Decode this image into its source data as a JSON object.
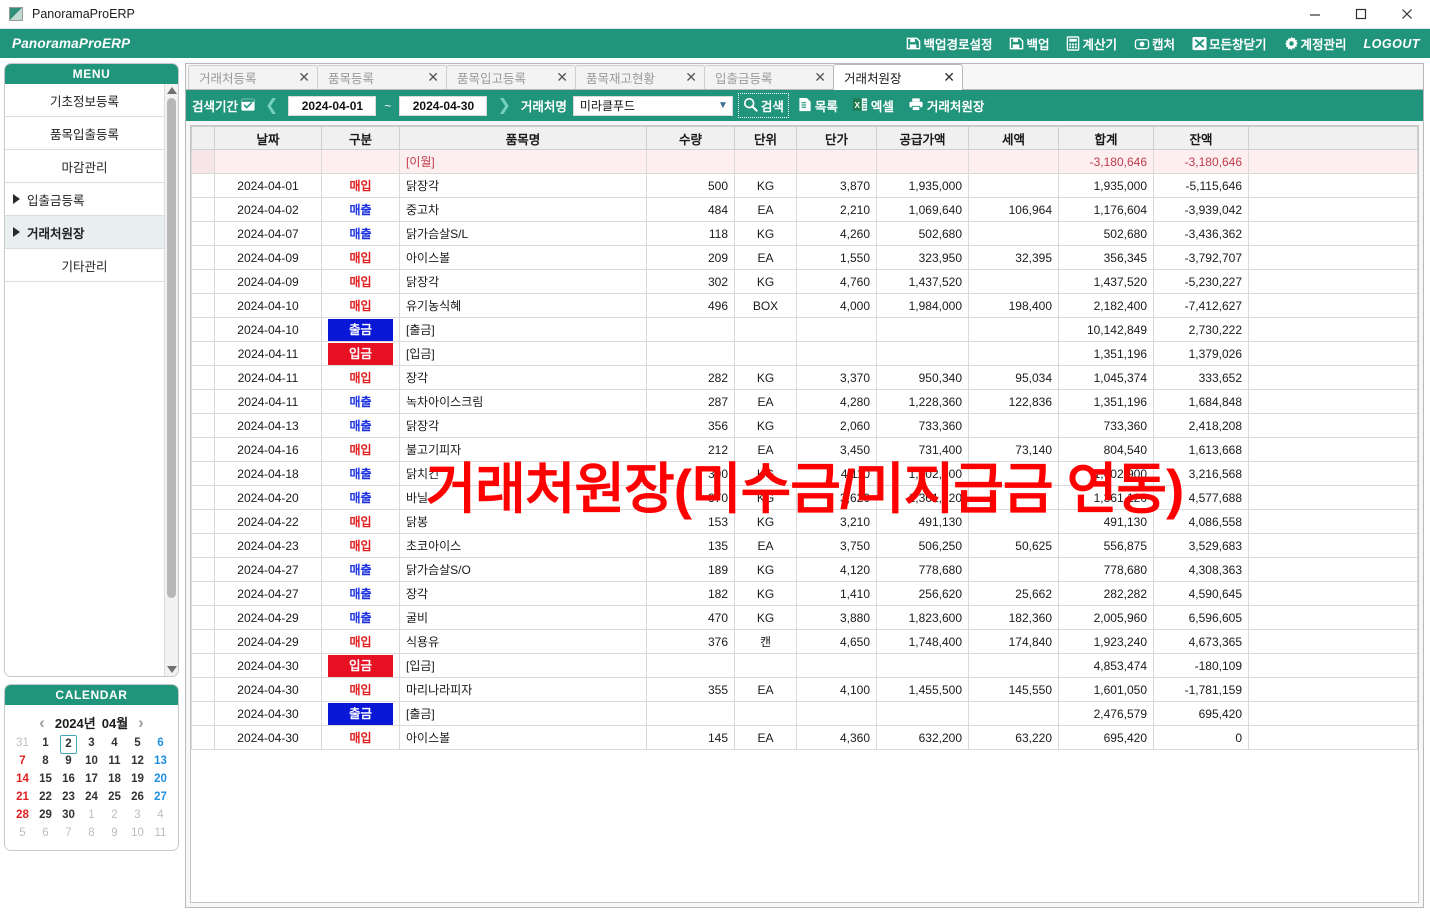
{
  "window": {
    "title": "PanoramaProERP",
    "minimize": "–",
    "maximize": "□",
    "close": "×"
  },
  "brand": {
    "logo": "PanoramaProERP",
    "logout": "LOGOUT",
    "accent": "#21947c",
    "topnav": [
      {
        "icon": "save-path-icon",
        "label": "백업경로설정"
      },
      {
        "icon": "save-icon",
        "label": "백업"
      },
      {
        "icon": "calculator-icon",
        "label": "계산기"
      },
      {
        "icon": "capture-icon",
        "label": "캡처"
      },
      {
        "icon": "close-all-windows-icon",
        "label": "모든창닫기"
      },
      {
        "icon": "gear-icon",
        "label": "계정관리"
      }
    ]
  },
  "sidebar": {
    "menu_title": "MENU",
    "items": [
      {
        "label": "기초정보등록",
        "arrow": false,
        "active": false
      },
      {
        "label": "품목입출등록",
        "arrow": false,
        "active": false
      },
      {
        "label": "마감관리",
        "arrow": false,
        "active": false
      },
      {
        "label": "입출금등록",
        "arrow": true,
        "active": false
      },
      {
        "label": "거래처원장",
        "arrow": true,
        "active": true
      },
      {
        "label": "기타관리",
        "arrow": false,
        "active": false
      }
    ],
    "calendar": {
      "title": "CALENDAR",
      "prev": "‹",
      "next": "›",
      "year": "2024년",
      "month": "04월",
      "today": 2,
      "weeks": [
        [
          {
            "d": "31",
            "t": "out"
          },
          {
            "d": "1",
            "t": "day"
          },
          {
            "d": "2",
            "t": "today"
          },
          {
            "d": "3",
            "t": "day"
          },
          {
            "d": "4",
            "t": "day"
          },
          {
            "d": "5",
            "t": "day"
          },
          {
            "d": "6",
            "t": "sat"
          }
        ],
        [
          {
            "d": "7",
            "t": "sun"
          },
          {
            "d": "8",
            "t": "day"
          },
          {
            "d": "9",
            "t": "day"
          },
          {
            "d": "10",
            "t": "day"
          },
          {
            "d": "11",
            "t": "day"
          },
          {
            "d": "12",
            "t": "day"
          },
          {
            "d": "13",
            "t": "sat"
          }
        ],
        [
          {
            "d": "14",
            "t": "sun"
          },
          {
            "d": "15",
            "t": "day"
          },
          {
            "d": "16",
            "t": "day"
          },
          {
            "d": "17",
            "t": "day"
          },
          {
            "d": "18",
            "t": "day"
          },
          {
            "d": "19",
            "t": "day"
          },
          {
            "d": "20",
            "t": "sat"
          }
        ],
        [
          {
            "d": "21",
            "t": "sun"
          },
          {
            "d": "22",
            "t": "day"
          },
          {
            "d": "23",
            "t": "day"
          },
          {
            "d": "24",
            "t": "day"
          },
          {
            "d": "25",
            "t": "day"
          },
          {
            "d": "26",
            "t": "day"
          },
          {
            "d": "27",
            "t": "sat"
          }
        ],
        [
          {
            "d": "28",
            "t": "sun"
          },
          {
            "d": "29",
            "t": "day"
          },
          {
            "d": "30",
            "t": "day"
          },
          {
            "d": "1",
            "t": "out"
          },
          {
            "d": "2",
            "t": "out"
          },
          {
            "d": "3",
            "t": "out"
          },
          {
            "d": "4",
            "t": "out"
          }
        ],
        [
          {
            "d": "5",
            "t": "out"
          },
          {
            "d": "6",
            "t": "out"
          },
          {
            "d": "7",
            "t": "out"
          },
          {
            "d": "8",
            "t": "out"
          },
          {
            "d": "9",
            "t": "out"
          },
          {
            "d": "10",
            "t": "out"
          },
          {
            "d": "11",
            "t": "out"
          }
        ]
      ]
    }
  },
  "tabs": [
    {
      "label": "거래처등록",
      "active": false,
      "close": "✕"
    },
    {
      "label": "품목등록",
      "active": false,
      "close": "✕"
    },
    {
      "label": "품목입고등록",
      "active": false,
      "close": "✕"
    },
    {
      "label": "품목재고현황",
      "active": false,
      "close": "✕"
    },
    {
      "label": "입출금등록",
      "active": false,
      "close": "✕"
    },
    {
      "label": "거래처원장",
      "active": true,
      "close": "✕"
    }
  ],
  "toolbar": {
    "period_label": "검색기간",
    "prev_arrow": "❮",
    "next_arrow": "❯",
    "date_from": "2024-04-01",
    "date_to": "2024-04-30",
    "tilde": "~",
    "vendor_label": "거래처명",
    "vendor_value": "미라클푸드",
    "buttons": [
      {
        "icon": "search-icon",
        "label": "검색",
        "focused": true
      },
      {
        "icon": "list-icon",
        "label": "목록",
        "focused": false
      },
      {
        "icon": "excel-icon",
        "label": "엑셀",
        "focused": false
      },
      {
        "icon": "printer-icon",
        "label": "거래처원장",
        "focused": false
      }
    ]
  },
  "watermark": "거래처원장(미수금/미지급금 연동)",
  "grid": {
    "columns": [
      "날짜",
      "구분",
      "품목명",
      "수량",
      "단위",
      "단가",
      "공급가액",
      "세액",
      "합계",
      "잔액",
      ""
    ],
    "rows": [
      {
        "style": "carry",
        "date": "",
        "kind": "",
        "kind_type": "none",
        "item": "[이월]",
        "qty": "",
        "unit": "",
        "price": "",
        "supply": "",
        "tax": "",
        "total": "-3,180,646",
        "balance": "-3,180,646"
      },
      {
        "style": "",
        "date": "2024-04-01",
        "kind": "매입",
        "kind_type": "in",
        "item": "닭장각",
        "qty": "500",
        "unit": "KG",
        "price": "3,870",
        "supply": "1,935,000",
        "tax": "",
        "total": "1,935,000",
        "balance": "-5,115,646"
      },
      {
        "style": "",
        "date": "2024-04-02",
        "kind": "매출",
        "kind_type": "out",
        "item": "중고차",
        "qty": "484",
        "unit": "EA",
        "price": "2,210",
        "supply": "1,069,640",
        "tax": "106,964",
        "total": "1,176,604",
        "balance": "-3,939,042"
      },
      {
        "style": "",
        "date": "2024-04-07",
        "kind": "매출",
        "kind_type": "out",
        "item": "닭가슴살S/L",
        "qty": "118",
        "unit": "KG",
        "price": "4,260",
        "supply": "502,680",
        "tax": "",
        "total": "502,680",
        "balance": "-3,436,362"
      },
      {
        "style": "",
        "date": "2024-04-09",
        "kind": "매입",
        "kind_type": "in",
        "item": "아이스볼",
        "qty": "209",
        "unit": "EA",
        "price": "1,550",
        "supply": "323,950",
        "tax": "32,395",
        "total": "356,345",
        "balance": "-3,792,707"
      },
      {
        "style": "",
        "date": "2024-04-09",
        "kind": "매입",
        "kind_type": "in",
        "item": "닭장각",
        "qty": "302",
        "unit": "KG",
        "price": "4,760",
        "supply": "1,437,520",
        "tax": "",
        "total": "1,437,520",
        "balance": "-5,230,227"
      },
      {
        "style": "",
        "date": "2024-04-10",
        "kind": "매입",
        "kind_type": "in",
        "item": "유기농식혜",
        "qty": "496",
        "unit": "BOX",
        "price": "4,000",
        "supply": "1,984,000",
        "tax": "198,400",
        "total": "2,182,400",
        "balance": "-7,412,627"
      },
      {
        "style": "",
        "date": "2024-04-10",
        "kind": "출금",
        "kind_type": "chip-withdraw",
        "item": "[출금]",
        "qty": "",
        "unit": "",
        "price": "",
        "supply": "",
        "tax": "",
        "total": "10,142,849",
        "balance": "2,730,222"
      },
      {
        "style": "",
        "date": "2024-04-11",
        "kind": "입금",
        "kind_type": "chip-deposit",
        "item": "[입금]",
        "qty": "",
        "unit": "",
        "price": "",
        "supply": "",
        "tax": "",
        "total": "1,351,196",
        "balance": "1,379,026"
      },
      {
        "style": "",
        "date": "2024-04-11",
        "kind": "매입",
        "kind_type": "in",
        "item": "장각",
        "qty": "282",
        "unit": "KG",
        "price": "3,370",
        "supply": "950,340",
        "tax": "95,034",
        "total": "1,045,374",
        "balance": "333,652"
      },
      {
        "style": "",
        "date": "2024-04-11",
        "kind": "매출",
        "kind_type": "out",
        "item": "녹차아이스크림",
        "qty": "287",
        "unit": "EA",
        "price": "4,280",
        "supply": "1,228,360",
        "tax": "122,836",
        "total": "1,351,196",
        "balance": "1,684,848"
      },
      {
        "style": "",
        "date": "2024-04-13",
        "kind": "매출",
        "kind_type": "out",
        "item": "닭장각",
        "qty": "356",
        "unit": "KG",
        "price": "2,060",
        "supply": "733,360",
        "tax": "",
        "total": "733,360",
        "balance": "2,418,208"
      },
      {
        "style": "",
        "date": "2024-04-16",
        "kind": "매입",
        "kind_type": "in",
        "item": "불고기피자",
        "qty": "212",
        "unit": "EA",
        "price": "3,450",
        "supply": "731,400",
        "tax": "73,140",
        "total": "804,540",
        "balance": "1,613,668"
      },
      {
        "style": "",
        "date": "2024-04-18",
        "kind": "매출",
        "kind_type": "out",
        "item": "닭치킨",
        "qty": "390",
        "unit": "KG",
        "price": "4,110",
        "supply": "1,602,900",
        "tax": "",
        "total": "1,602,900",
        "balance": "3,216,568"
      },
      {
        "style": "",
        "date": "2024-04-20",
        "kind": "매출",
        "kind_type": "out",
        "item": "바닐",
        "qty": "370",
        "unit": "KG",
        "price": "3,620",
        "supply": "1,361,120",
        "tax": "",
        "total": "1,361,120",
        "balance": "4,577,688"
      },
      {
        "style": "",
        "date": "2024-04-22",
        "kind": "매입",
        "kind_type": "in",
        "item": "닭봉",
        "qty": "153",
        "unit": "KG",
        "price": "3,210",
        "supply": "491,130",
        "tax": "",
        "total": "491,130",
        "balance": "4,086,558"
      },
      {
        "style": "",
        "date": "2024-04-23",
        "kind": "매입",
        "kind_type": "in",
        "item": "초코아이스",
        "qty": "135",
        "unit": "EA",
        "price": "3,750",
        "supply": "506,250",
        "tax": "50,625",
        "total": "556,875",
        "balance": "3,529,683"
      },
      {
        "style": "",
        "date": "2024-04-27",
        "kind": "매출",
        "kind_type": "out",
        "item": "닭가슴살S/O",
        "qty": "189",
        "unit": "KG",
        "price": "4,120",
        "supply": "778,680",
        "tax": "",
        "total": "778,680",
        "balance": "4,308,363"
      },
      {
        "style": "",
        "date": "2024-04-27",
        "kind": "매출",
        "kind_type": "out",
        "item": "장각",
        "qty": "182",
        "unit": "KG",
        "price": "1,410",
        "supply": "256,620",
        "tax": "25,662",
        "total": "282,282",
        "balance": "4,590,645"
      },
      {
        "style": "",
        "date": "2024-04-29",
        "kind": "매출",
        "kind_type": "out",
        "item": "굴비",
        "qty": "470",
        "unit": "KG",
        "price": "3,880",
        "supply": "1,823,600",
        "tax": "182,360",
        "total": "2,005,960",
        "balance": "6,596,605"
      },
      {
        "style": "",
        "date": "2024-04-29",
        "kind": "매입",
        "kind_type": "in",
        "item": "식용유",
        "qty": "376",
        "unit": "캔",
        "price": "4,650",
        "supply": "1,748,400",
        "tax": "174,840",
        "total": "1,923,240",
        "balance": "4,673,365"
      },
      {
        "style": "",
        "date": "2024-04-30",
        "kind": "입금",
        "kind_type": "chip-deposit",
        "item": "[입금]",
        "qty": "",
        "unit": "",
        "price": "",
        "supply": "",
        "tax": "",
        "total": "4,853,474",
        "balance": "-180,109"
      },
      {
        "style": "",
        "date": "2024-04-30",
        "kind": "매입",
        "kind_type": "in",
        "item": "마리나라피자",
        "qty": "355",
        "unit": "EA",
        "price": "4,100",
        "supply": "1,455,500",
        "tax": "145,550",
        "total": "1,601,050",
        "balance": "-1,781,159"
      },
      {
        "style": "",
        "date": "2024-04-30",
        "kind": "출금",
        "kind_type": "chip-withdraw",
        "item": "[출금]",
        "qty": "",
        "unit": "",
        "price": "",
        "supply": "",
        "tax": "",
        "total": "2,476,579",
        "balance": "695,420"
      },
      {
        "style": "",
        "date": "2024-04-30",
        "kind": "매입",
        "kind_type": "in",
        "item": "아이스볼",
        "qty": "145",
        "unit": "EA",
        "price": "4,360",
        "supply": "632,200",
        "tax": "63,220",
        "total": "695,420",
        "balance": "0"
      }
    ]
  }
}
